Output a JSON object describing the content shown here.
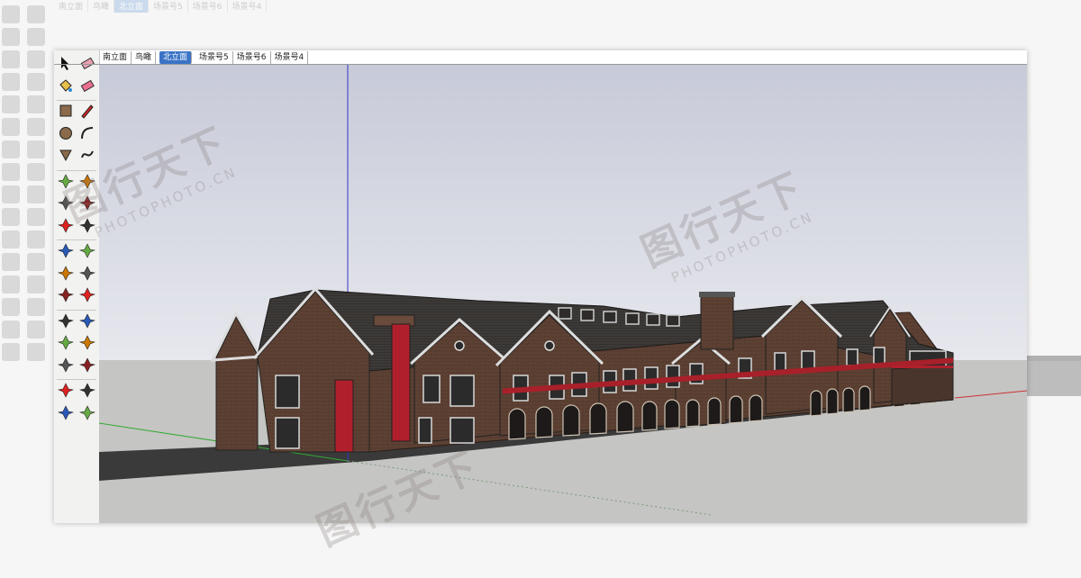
{
  "app": {
    "scene_tabs": [
      {
        "label": "南立面",
        "active": false
      },
      {
        "label": "鸟瞰",
        "active": false
      },
      {
        "label": "北立面",
        "active": true
      },
      {
        "label": "场景号5",
        "active": false
      },
      {
        "label": "场景号6",
        "active": false
      },
      {
        "label": "场景号4",
        "active": false
      }
    ]
  },
  "toolbar": {
    "tools": [
      "select-icon",
      "eraser-icon",
      "paint-bucket-icon",
      "eraser-pink-icon",
      "rectangle-icon",
      "pencil-icon",
      "circle-icon",
      "arc-icon",
      "polygon-icon",
      "freehand-icon",
      "move-icon",
      "push-pull-icon",
      "rotate-icon",
      "follow-me-icon",
      "scale-icon",
      "offset-icon",
      "tape-measure-icon",
      "dimension-icon",
      "protractor-icon",
      "text-icon",
      "axes-icon",
      "3d-text-icon",
      "orbit-icon",
      "pan-icon",
      "zoom-icon",
      "zoom-window-icon",
      "zoom-extents-icon",
      "previous-view-icon",
      "position-camera-icon",
      "look-around-icon",
      "walk-icon",
      "section-plane-icon"
    ]
  },
  "watermark": {
    "brand_cn": "图行天下",
    "brand_en": "PHOTOPHOTO.CN"
  },
  "colors": {
    "sky": "#d8dbe6",
    "ground": "#c4c4c2",
    "roof": "#3c3836",
    "brick": "#6a4a3a",
    "accent_red": "#b0202c",
    "axis_blue": "#3333cc",
    "axis_red": "#cc3333",
    "axis_green": "#33aa33",
    "tab_active": "#3a73c6"
  }
}
